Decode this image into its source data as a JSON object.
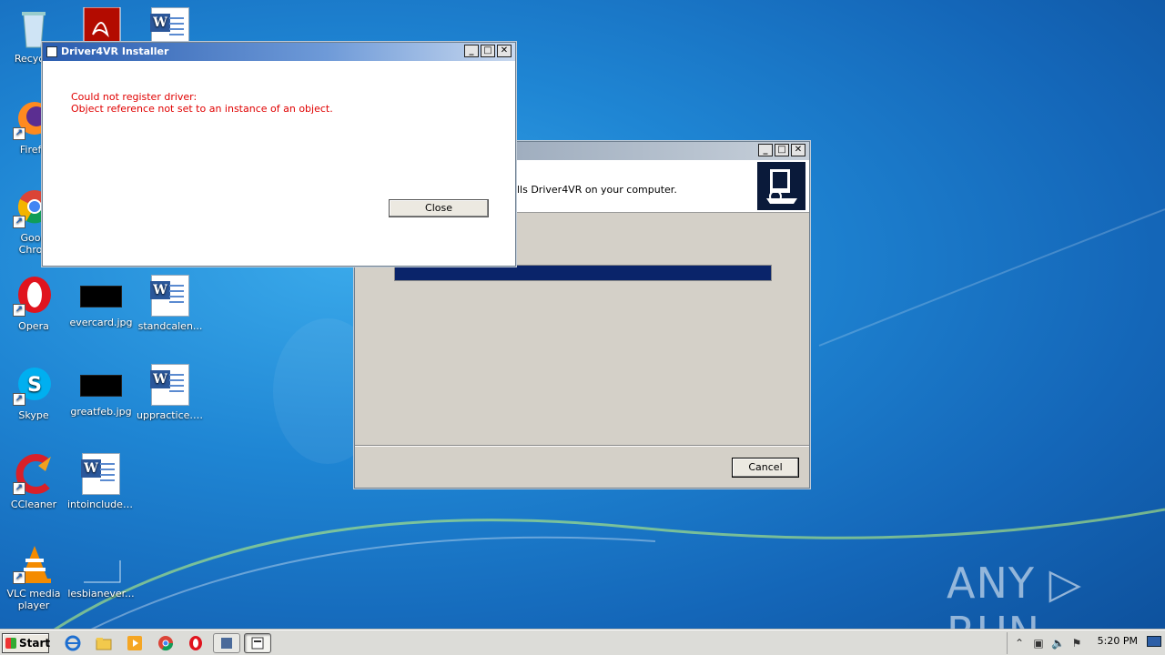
{
  "desktop": {
    "icons": [
      {
        "label": "Recycle"
      },
      {
        "label": "Firefo"
      },
      {
        "label": "Goog\nChron"
      },
      {
        "label": "Opera"
      },
      {
        "label": "evercard.jpg"
      },
      {
        "label": "standcalen..."
      },
      {
        "label": "Skype"
      },
      {
        "label": "greatfeb.jpg"
      },
      {
        "label": "uppractice.rtf"
      },
      {
        "label": "CCleaner"
      },
      {
        "label": "intoincludes..."
      },
      {
        "label": "VLC media\nplayer"
      },
      {
        "label": "lesbianever..."
      }
    ],
    "watermark": "ANY ▷ RUN"
  },
  "error_dialog": {
    "title": "Driver4VR Installer",
    "message_line1": "Could not register driver:",
    "message_line2": "Object reference not set to an instance of an object.",
    "close_label": "Close",
    "message_color": "#e00000"
  },
  "installer_window": {
    "header_text": "lls Driver4VR on your computer.",
    "progress_fraction": 1.0,
    "cancel_label": "Cancel"
  },
  "taskbar": {
    "start_label": "Start",
    "clock": "5:20 PM"
  }
}
